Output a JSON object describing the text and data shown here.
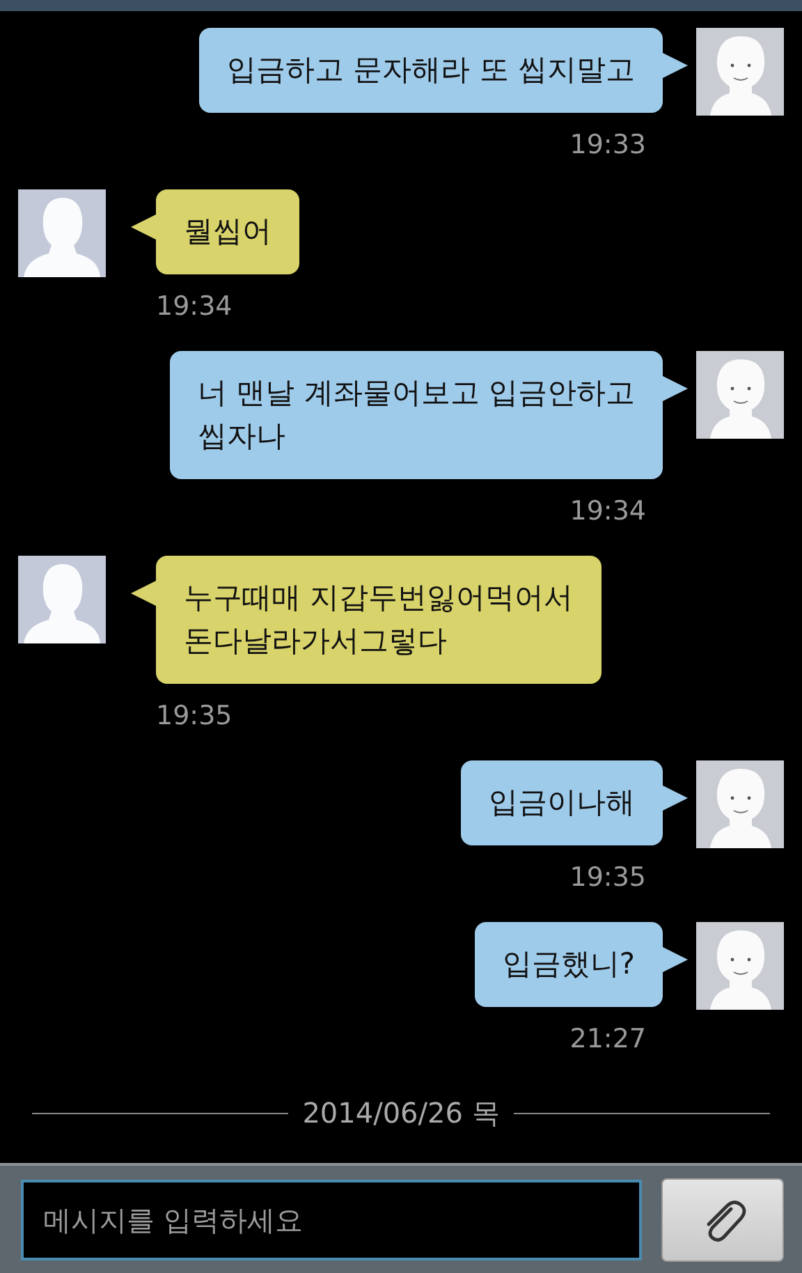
{
  "messages": [
    {
      "kind": "sent",
      "text": "입금하고 문자해라 또 씹지말고",
      "time": "19:33"
    },
    {
      "kind": "received",
      "text": "뭘씹어",
      "time": "19:34"
    },
    {
      "kind": "sent",
      "text": "너 맨날 계좌물어보고 입금안하고\n씹자나",
      "time": "19:34"
    },
    {
      "kind": "received",
      "text": "누구때매 지갑두번잃어먹어서\n돈다날라가서그렇다",
      "time": "19:35"
    },
    {
      "kind": "sent",
      "text": "입금이나해",
      "time": "19:35"
    },
    {
      "kind": "sent",
      "text": "입금했니?",
      "time": "21:27"
    }
  ],
  "date_divider": "2014/06/26 목",
  "composer": {
    "placeholder": "메시지를 입력하세요"
  }
}
